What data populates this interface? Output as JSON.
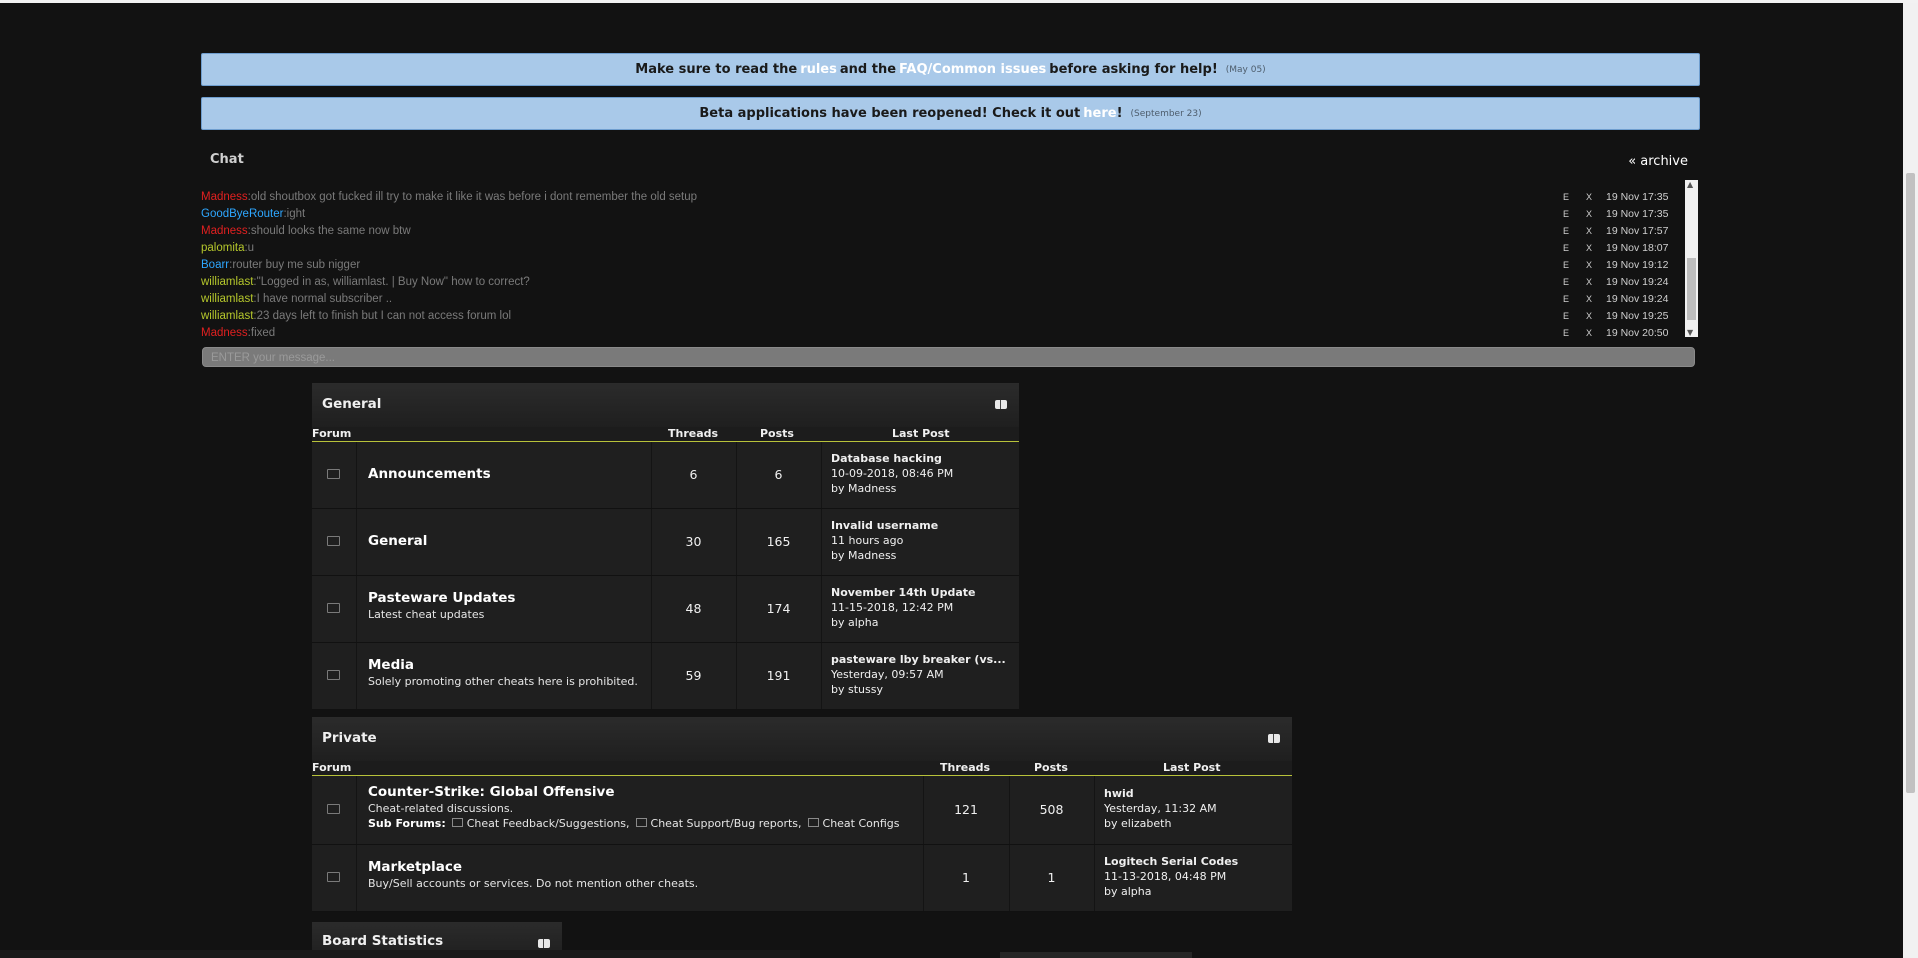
{
  "announcements": [
    {
      "prefix": "Make sure to read the",
      "link1": "rules",
      "mid": "and the",
      "link2": "FAQ/Common issues",
      "suffix": "before asking for help!",
      "date": "(May 05)"
    },
    {
      "prefix": "Beta applications have been reopened! Check it out",
      "link": "here",
      "suffix": "!",
      "date": "(September 23)"
    }
  ],
  "chat": {
    "title": "Chat",
    "archive_label": "« archive",
    "input_placeholder": "ENTER your message...",
    "edit_label": "E",
    "delete_label": "X",
    "messages": [
      {
        "user": "Madness",
        "color": "#e02020",
        "text": "old shoutbox got fucked ill try to make it like it was before i dont remember the old setup",
        "time": "19 Nov 17:35"
      },
      {
        "user": "GoodByeRouter",
        "color": "#2ea7ff",
        "text": "ight",
        "time": "19 Nov 17:35"
      },
      {
        "user": "Madness",
        "color": "#e02020",
        "text": "should looks the same now btw",
        "time": "19 Nov 17:57"
      },
      {
        "user": "palomita",
        "color": "#b5c72c",
        "text": "u",
        "time": "19 Nov 18:07"
      },
      {
        "user": "Boarr",
        "color": "#2ea7ff",
        "text": "router buy me sub nigger",
        "time": "19 Nov 19:12"
      },
      {
        "user": "williamlast",
        "color": "#b5c72c",
        "text": "\"Logged in as, williamlast. | Buy Now\" how to correct?",
        "time": "19 Nov 19:24"
      },
      {
        "user": "williamlast",
        "color": "#b5c72c",
        "text": "I have normal subscriber ..",
        "time": "19 Nov 19:24"
      },
      {
        "user": "williamlast",
        "color": "#b5c72c",
        "text": "23 days left to finish but I can not access forum lol",
        "time": "19 Nov 19:25"
      },
      {
        "user": "Madness",
        "color": "#e02020",
        "text": "fixed",
        "time": "19 Nov 20:50"
      }
    ]
  },
  "categories": [
    {
      "title": "General",
      "columns": {
        "forum": "Forum",
        "threads": "Threads",
        "posts": "Posts",
        "last_post": "Last Post"
      },
      "forums": [
        {
          "name": "Announcements",
          "desc": "",
          "threads": "6",
          "posts": "6",
          "lp_title": "Database hacking",
          "lp_date": "10-09-2018, 08:46 PM",
          "lp_by": "by Madness"
        },
        {
          "name": "General",
          "desc": "",
          "threads": "30",
          "posts": "165",
          "lp_title": "Invalid username",
          "lp_date": "11 hours ago",
          "lp_by": "by Madness"
        },
        {
          "name": "Pasteware Updates",
          "desc": "Latest cheat updates",
          "threads": "48",
          "posts": "174",
          "lp_title": "November 14th Update",
          "lp_date": "11-15-2018, 12:42 PM",
          "lp_by": "by alpha"
        },
        {
          "name": "Media",
          "desc": "Solely promoting other cheats here is prohibited.",
          "threads": "59",
          "posts": "191",
          "lp_title": "pasteware lby breaker (vs...",
          "lp_date": "Yesterday, 09:57 AM",
          "lp_by": "by stussy"
        }
      ]
    },
    {
      "title": "Private",
      "columns": {
        "forum": "Forum",
        "threads": "Threads",
        "posts": "Posts",
        "last_post": "Last Post"
      },
      "forums": [
        {
          "name": "Counter-Strike: Global Offensive",
          "desc": "Cheat-related discussions.",
          "sub_label": "Sub Forums:",
          "subs": [
            "Cheat Feedback/Suggestions,",
            "Cheat Support/Bug reports,",
            "Cheat Configs"
          ],
          "threads": "121",
          "posts": "508",
          "lp_title": "hwid",
          "lp_date": "Yesterday, 11:32 AM",
          "lp_by": "by elizabeth"
        },
        {
          "name": "Marketplace",
          "desc": "Buy/Sell accounts or services. Do not mention other cheats.",
          "threads": "1",
          "posts": "1",
          "lp_title": "Logitech Serial Codes",
          "lp_date": "11-13-2018, 04:48 PM",
          "lp_by": "by alpha"
        }
      ]
    }
  ],
  "board_stats": {
    "title": "Board Statistics"
  }
}
